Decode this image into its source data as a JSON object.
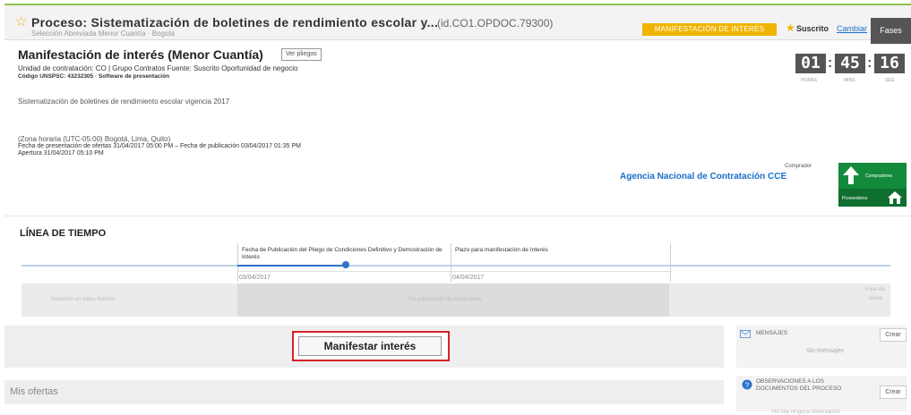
{
  "header": {
    "title": "Proceso: Sistematización de boletines de rendimiento escolar y...",
    "process_id": "(id.CO1.OPDOC.79300)",
    "subtitle": "Selección Abreviada Menor Cuantía · Bogotá",
    "badge": "MANIFESTACIÓN DE INTERÉS",
    "suscrito_label": "Suscrito",
    "cambiar_link": "Cambiar",
    "fases_button": "Fases"
  },
  "summary": {
    "title": "Manifestación de interés (Menor Cuantía)",
    "ver_pliegos": "Ver pliegos",
    "unidad": "Unidad de contratación: CO | Grupo Contratos Fuente: Suscrito Oportunidad de negocio",
    "codigo": "Código UNSPSC: 43232305 · Software de presentación",
    "description": "Sistematización de boletines de rendimiento escolar vigencia 2017",
    "zona": "(Zona horaria (UTC-05:00) Bogotá, Lima, Quito)",
    "fechas": "Fecha de presentación de ofertas 31/04/2017 05:00 PM  –  Fecha de publicación 03/04/2017 01:35 PM",
    "apertura": "Apertura 31/04/2017 05:10 PM",
    "comprador_label": "Comprador",
    "comprador": "Agencia Nacional de Contratación CCE",
    "logo_top": "Compradores",
    "logo_bottom": "Proveedores"
  },
  "timer": {
    "hours": "01",
    "minutes": "45",
    "seconds": "16",
    "hours_label": "HORAS",
    "minutes_label": "MINS",
    "seconds_label": "SEG"
  },
  "timeline": {
    "title": "LÍNEA DE TIEMPO",
    "col1_header": "Fecha de Publicación del Pliego de Condiciones Definitivo y Demostración de Interés",
    "col2_header": "Plazo para manifestación de Interés",
    "col1_date": "03/04/2017",
    "col2_date": "04/04/2017",
    "stage_left": "Selección en datos ficticios",
    "stage_mid": "Pre-publicación de condiciones",
    "stage_right": "Fase de oferta"
  },
  "actions": {
    "manifestar_button": "Manifestar interés",
    "mis_ofertas": "Mis ofertas"
  },
  "sidebar": {
    "mensajes_label": "MENSAJES",
    "mensajes_button": "Crear",
    "sin_mensajes": "Sin mensajes",
    "observaciones_label": "OBSERVACIONES A LOS DOCUMENTOS DEL PROCESO",
    "observaciones_button": "Crear",
    "no_hay": "No hay ninguna observación"
  }
}
